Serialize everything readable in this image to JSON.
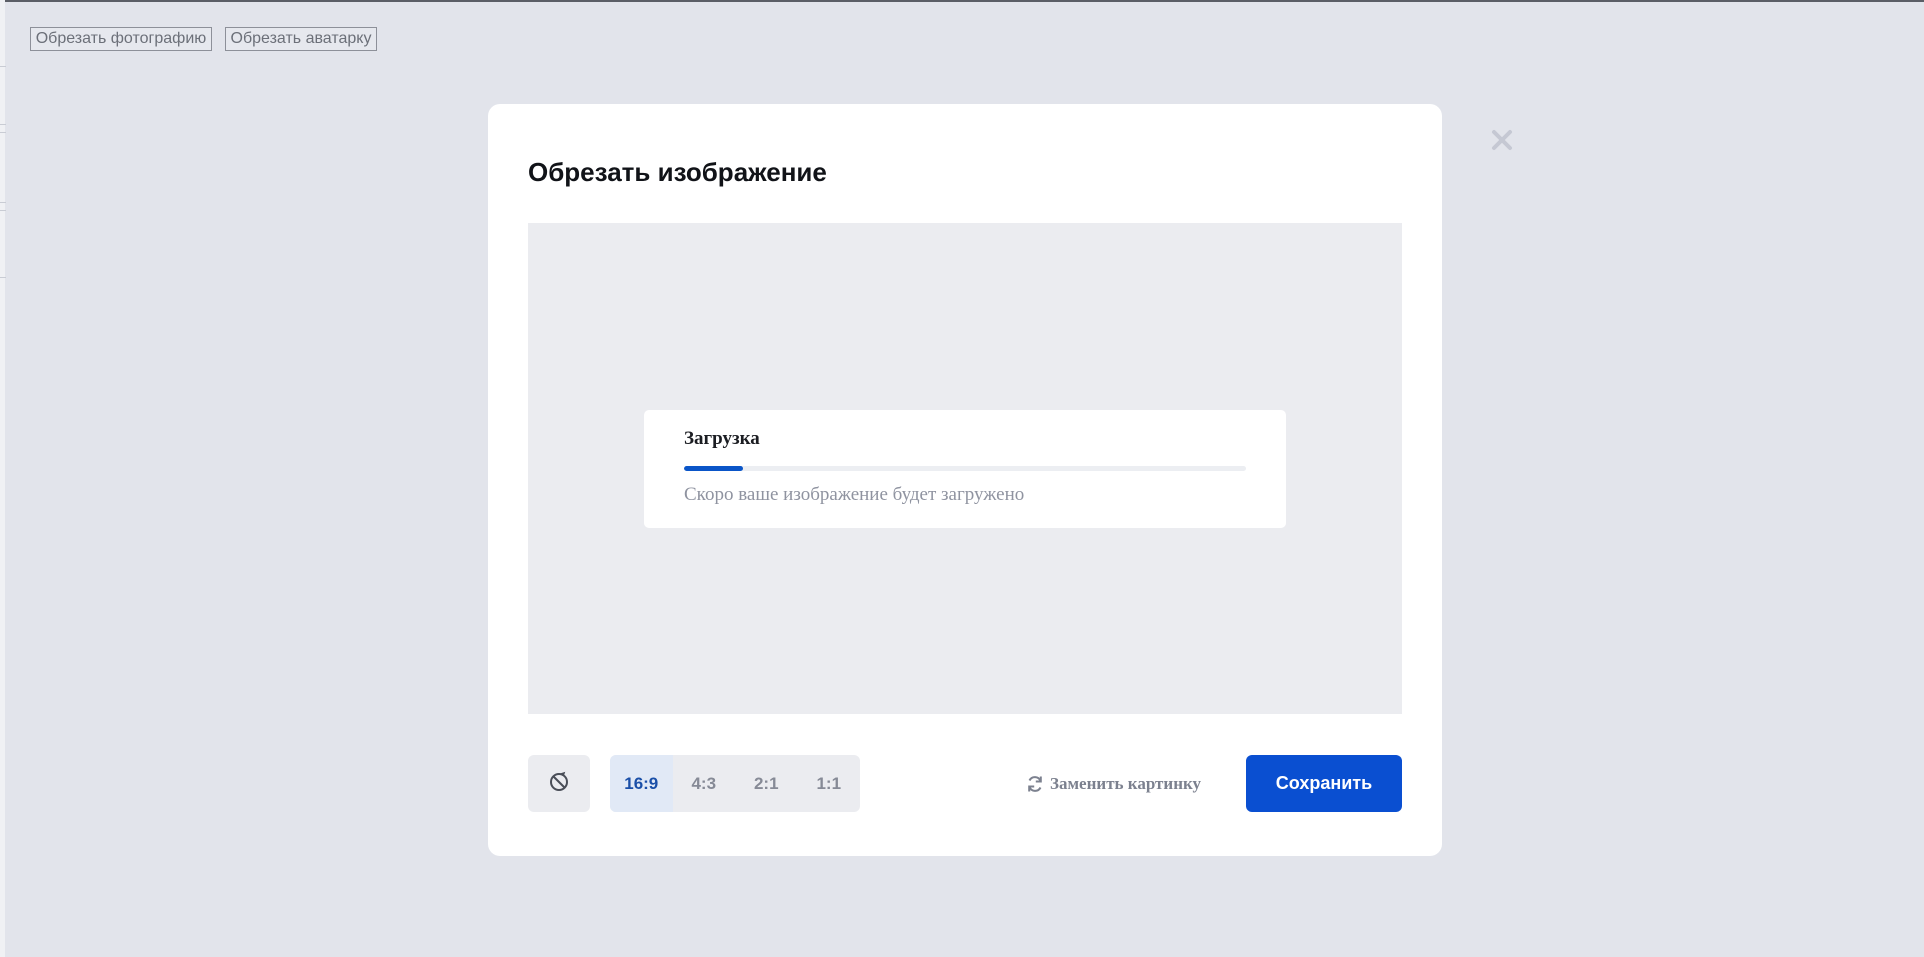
{
  "top_buttons": {
    "crop_photo": "Обрезать фотографию",
    "crop_avatar": "Обрезать аватарку"
  },
  "modal": {
    "title": "Обрезать изображение",
    "close_icon": "close-icon",
    "loader": {
      "title": "Загрузка",
      "progress": 0.105,
      "message": "Скоро ваше изображение будет загружено"
    },
    "toolbar": {
      "rotate_icon": "rotate-icon",
      "ratios": [
        {
          "label": "16:9",
          "active": true
        },
        {
          "label": "4:3",
          "active": false
        },
        {
          "label": "2:1",
          "active": false
        },
        {
          "label": "1:1",
          "active": false
        }
      ],
      "replace_icon": "refresh-icon",
      "replace_label": "Заменить картинку",
      "save_label": "Сохранить"
    }
  },
  "colors": {
    "page_background": "#e2e4eb",
    "accent": "#0a4fd1",
    "progress_fill": "#0a55c8",
    "active_ratio_text": "#1a4fa8",
    "muted_text": "#8f93a0"
  }
}
